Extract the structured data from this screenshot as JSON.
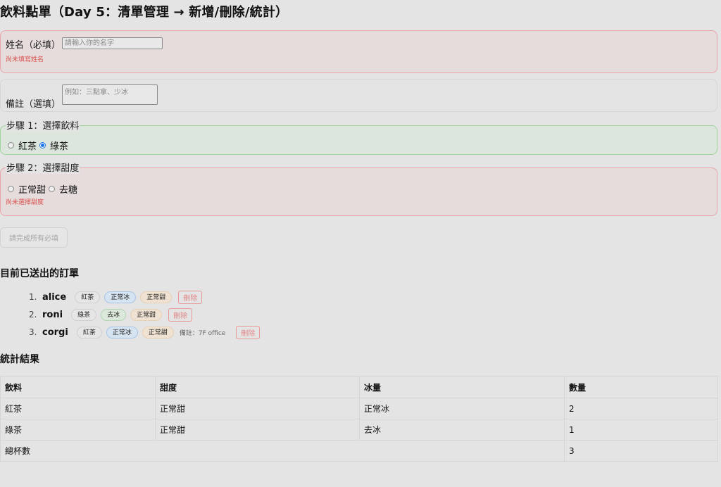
{
  "page": {
    "title": "飲料點單（Day 5：清單管理 → 新增/刪除/統計）"
  },
  "form": {
    "name_label": "姓名（必填）",
    "name_placeholder": "請輸入你的名字",
    "name_value": "",
    "name_error": "尚未填寫姓名",
    "note_label": "備註（選填）",
    "note_placeholder": "例如：三點拿、少冰",
    "step1": {
      "legend": "步驟 1：選擇飲料",
      "options": [
        "紅茶",
        "綠茶"
      ],
      "selected": "綠茶"
    },
    "step2": {
      "legend": "步驟 2：選擇甜度",
      "options": [
        "正常甜",
        "去糖"
      ],
      "selected": "",
      "error": "尚未選擇甜度"
    },
    "submit_label": "請完成所有必填"
  },
  "orders": {
    "title": "目前已送出的訂單",
    "delete_label": "刪除",
    "items": [
      {
        "num": "1.",
        "name": "alice",
        "drink": "紅茶",
        "ice": "正常冰",
        "sweet": "正常甜",
        "note": ""
      },
      {
        "num": "2.",
        "name": "roni",
        "drink": "綠茶",
        "ice": "去冰",
        "sweet": "正常甜",
        "note": ""
      },
      {
        "num": "3.",
        "name": "corgi",
        "drink": "紅茶",
        "ice": "正常冰",
        "sweet": "正常甜",
        "note": "備註：7F office"
      }
    ]
  },
  "stats": {
    "title": "統計結果",
    "headers": [
      "飲料",
      "甜度",
      "冰量",
      "數量"
    ],
    "rows": [
      [
        "紅茶",
        "正常甜",
        "正常冰",
        "2"
      ],
      [
        "綠茶",
        "正常甜",
        "去冰",
        "1"
      ]
    ],
    "total_label": "總杯數",
    "total_value": "3"
  },
  "colors": {
    "error_border": "#e9a5a9",
    "ok_border": "#9fd49a",
    "radio_accent": "#1a73e8",
    "error_text": "#d9534f"
  }
}
